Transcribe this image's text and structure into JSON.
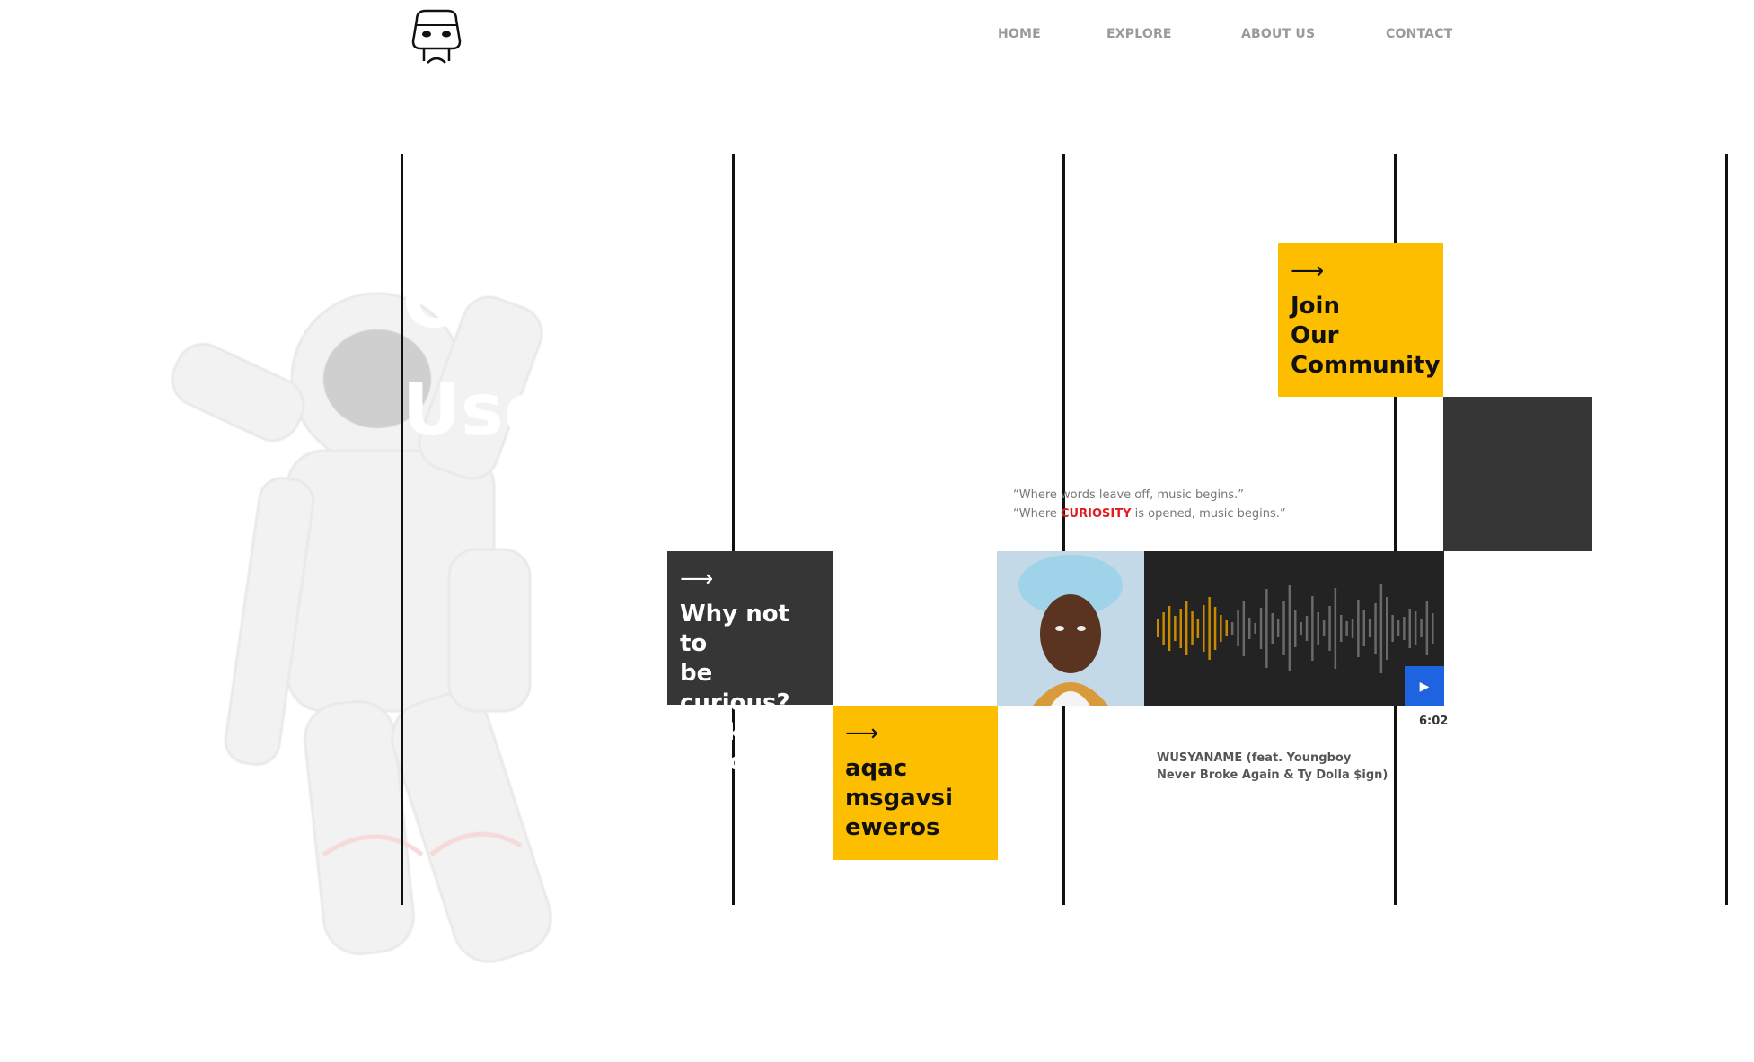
{
  "header": {
    "logo_icon": "mascot-face-icon",
    "nav": [
      "HOME",
      "EXPLORE",
      "ABOUT US",
      "CONTACT"
    ]
  },
  "hero": {
    "line1": "C",
    "line2": "User"
  },
  "cards": {
    "join": {
      "arrow": "⟶",
      "label": "Join\nOur\nCommunity"
    },
    "curious": {
      "arrow": "⟶",
      "label": "Why not to\nbe curious?\nLook Beyond!"
    },
    "random": {
      "arrow": "⟶",
      "label": "aqac\nmsgavsi\neweros"
    }
  },
  "quote": {
    "line1": "“Where words leave off, music begins.”",
    "line2_pre": "“Where ",
    "line2_highlight": "CURIOSITY",
    "line2_post": " is opened, music begins.”"
  },
  "player": {
    "play_icon": "play-icon",
    "duration": "6:02",
    "track_title": "WUSYANAME (feat. Youngboy Never Broke Again & Ty Dolla $ign)",
    "progress": 0.25
  },
  "colors": {
    "yellow": "#fdbe00",
    "dark": "#363636",
    "accent_red": "#e11d24",
    "play_blue": "#1e63e0",
    "wave_played": "#c98a00",
    "wave_unplayed": "#6a6a6a"
  }
}
